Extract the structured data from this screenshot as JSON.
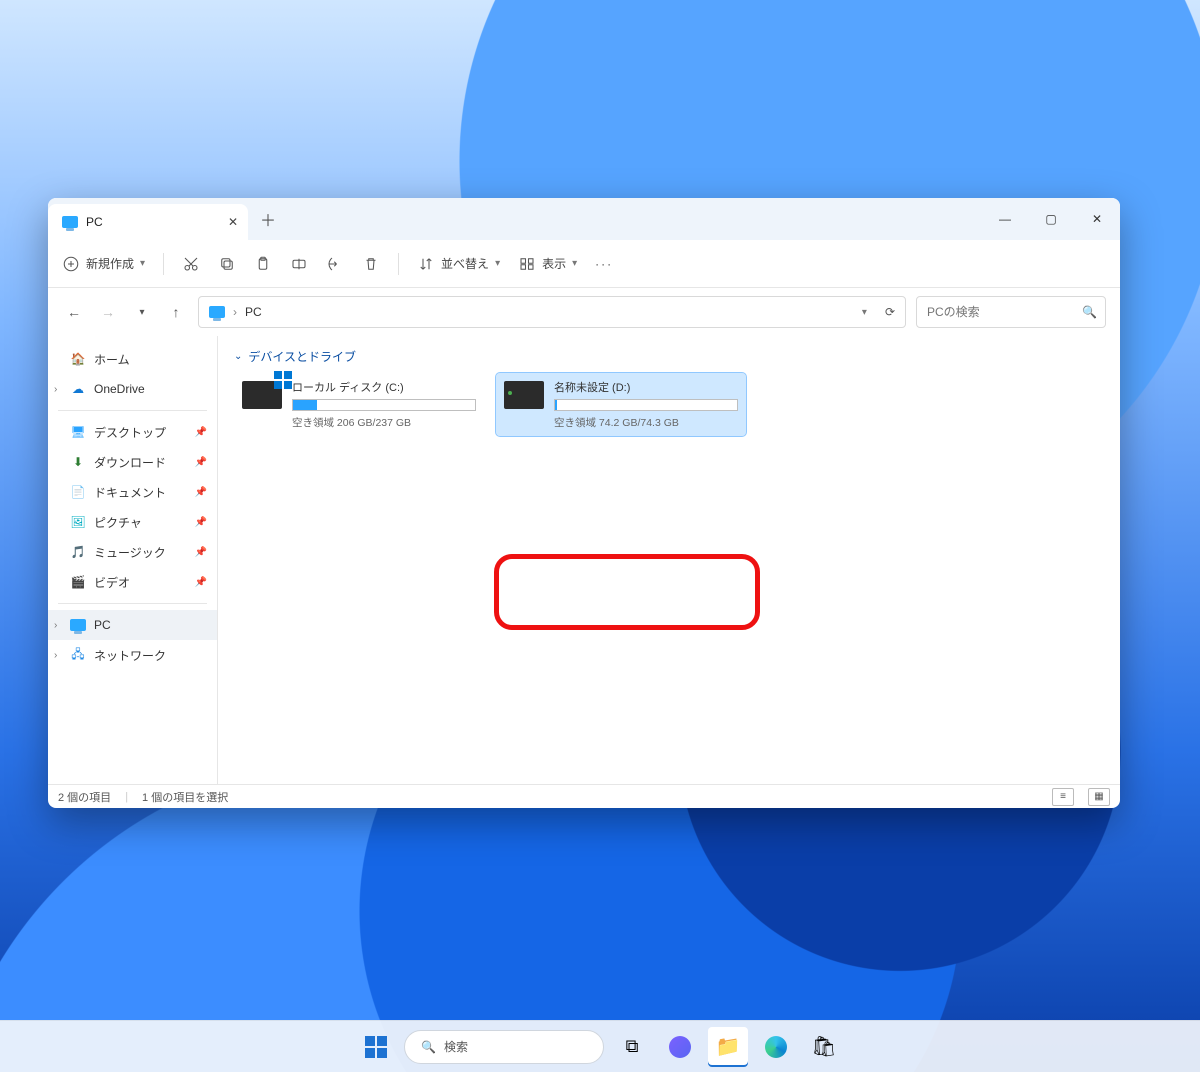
{
  "window": {
    "tab_title": "PC",
    "breadcrumb_root": "PC"
  },
  "toolbar": {
    "new_label": "新規作成",
    "sort_label": "並べ替え",
    "view_label": "表示"
  },
  "search": {
    "placeholder": "PCの検索"
  },
  "sidebar": {
    "home": "ホーム",
    "onedrive": "OneDrive",
    "desktop": "デスクトップ",
    "downloads": "ダウンロード",
    "documents": "ドキュメント",
    "pictures": "ピクチャ",
    "music": "ミュージック",
    "videos": "ビデオ",
    "pc": "PC",
    "network": "ネットワーク"
  },
  "content": {
    "group_title": "デバイスとドライブ",
    "drives": [
      {
        "name": "ローカル ディスク (C:)",
        "free_text": "空き領域 206 GB/237 GB",
        "fill_pct": 13,
        "selected": false,
        "is_windows": true
      },
      {
        "name": "名称未設定 (D:)",
        "free_text": "空き領域 74.2 GB/74.3 GB",
        "fill_pct": 1,
        "selected": true,
        "is_windows": false
      }
    ]
  },
  "status": {
    "count": "2 個の項目",
    "selection": "1 個の項目を選択"
  },
  "taskbar": {
    "search_label": "検索"
  }
}
